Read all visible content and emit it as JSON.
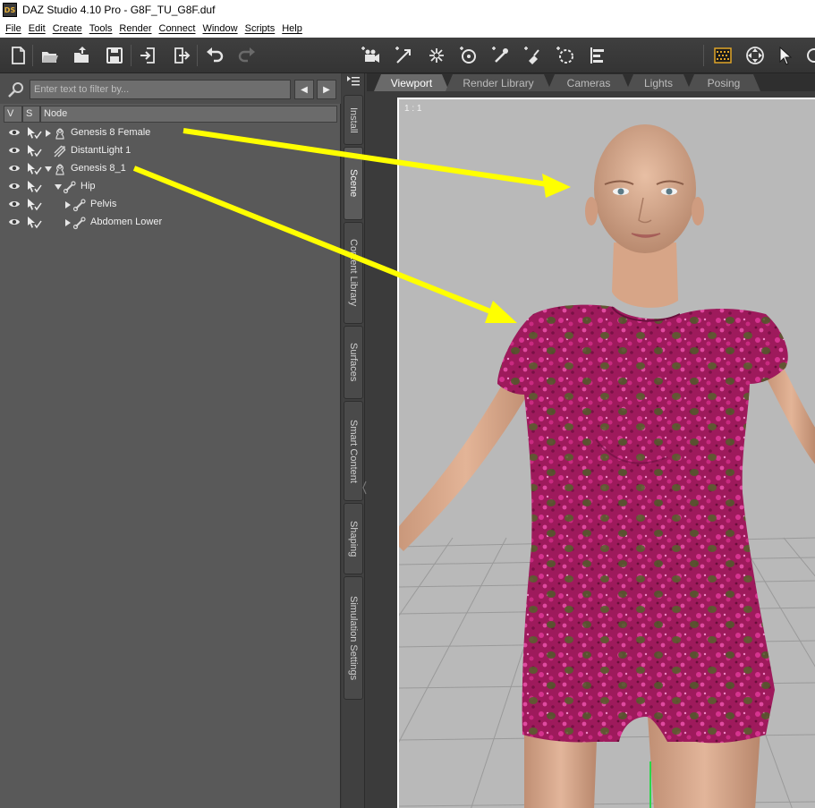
{
  "window": {
    "title": "DAZ Studio 4.10 Pro - G8F_TU_G8F.duf",
    "logo": "DS"
  },
  "menu": [
    "File",
    "Edit",
    "Create",
    "Tools",
    "Render",
    "Connect",
    "Window",
    "Scripts",
    "Help"
  ],
  "toolbar": {
    "left_icons": [
      "new-file-icon",
      "open-file-icon",
      "merge-open-icon",
      "save-icon",
      "import-icon",
      "export-icon",
      "undo-icon",
      "redo-icon"
    ],
    "tool_icons": [
      "camera-cube-icon",
      "node-select-icon",
      "universal-tool-icon",
      "rotate-tool-icon",
      "joint-editor-icon",
      "surface-selection-icon",
      "geometry-editor-icon",
      "align-icon",
      "render-icon",
      "orbit-icon",
      "pointer-icon",
      "pan-icon"
    ]
  },
  "scene": {
    "filter_placeholder": "Enter text to filter by...",
    "columns": {
      "v": "V",
      "s": "S",
      "node": "Node"
    },
    "nodes": [
      {
        "label": "Genesis 8 Female",
        "icon": "figure-icon",
        "expander": "collapsed",
        "depth": 0
      },
      {
        "label": "DistantLight 1",
        "icon": "distant-light-icon",
        "expander": "none",
        "depth": 0
      },
      {
        "label": "Genesis 8_1",
        "icon": "figure-icon",
        "expander": "expanded",
        "depth": 0
      },
      {
        "label": "Hip",
        "icon": "bone-icon",
        "expander": "expanded",
        "depth": 1
      },
      {
        "label": "Pelvis",
        "icon": "bone-icon",
        "expander": "collapsed",
        "depth": 2
      },
      {
        "label": "Abdomen Lower",
        "icon": "bone-icon",
        "expander": "collapsed",
        "depth": 2
      }
    ]
  },
  "side_tabs": [
    "Install",
    "Scene",
    "Content Library",
    "Surfaces",
    "Smart Content",
    "Shaping",
    "Simulation Settings"
  ],
  "active_side_tab": "Scene",
  "viewport_tabs": [
    "Viewport",
    "Render Library",
    "Cameras",
    "Lights",
    "Posing"
  ],
  "active_viewport_tab": "Viewport",
  "viewport": {
    "aspect_label": "1 : 1"
  },
  "colors": {
    "annotation_arrow": "#ffff00",
    "dress_base": "#a8185f",
    "dress_accent": "#4e5a28",
    "skin": "#d9a98b",
    "viewport_bg": "#b9b9b9"
  }
}
